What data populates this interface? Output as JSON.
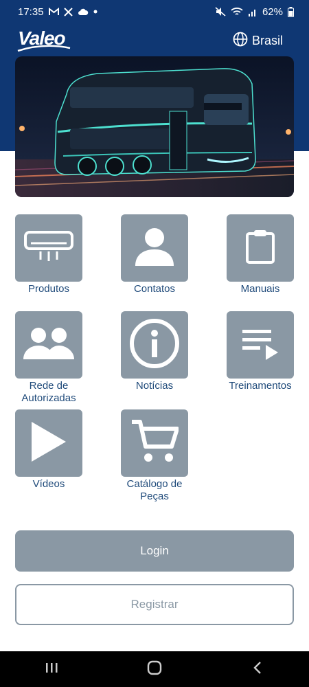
{
  "status_bar": {
    "time": "17:35",
    "battery": "62%",
    "left_icons": [
      "gmail-icon",
      "x-icon",
      "cloud-icon",
      "dot-icon"
    ],
    "right_icons": [
      "mute-icon",
      "wifi-icon",
      "signal-icon",
      "battery-icon"
    ]
  },
  "header": {
    "logo_text": "Valeo",
    "language_label": "Brasil",
    "background_color": "#0f3773"
  },
  "banner": {
    "image": "bus-illustration"
  },
  "menu": {
    "items": [
      {
        "label": "Produtos",
        "icon": "air-conditioner-icon"
      },
      {
        "label": "Contatos",
        "icon": "person-icon"
      },
      {
        "label": "Manuais",
        "icon": "clipboard-icon"
      },
      {
        "label": "Rede de Autorizadas",
        "icon": "people-icon"
      },
      {
        "label": "Notícias",
        "icon": "info-icon"
      },
      {
        "label": "Treinamentos",
        "icon": "playlist-icon"
      },
      {
        "label": "Vídeos",
        "icon": "play-icon"
      },
      {
        "label": "Catálogo de Peças",
        "icon": "cart-icon"
      }
    ],
    "tile_color": "#8a98a4",
    "label_color": "#1f4a7a"
  },
  "buttons": {
    "login_label": "Login",
    "register_label": "Registrar"
  },
  "nav": {
    "icons": [
      "recents-icon",
      "home-icon",
      "back-icon"
    ]
  }
}
